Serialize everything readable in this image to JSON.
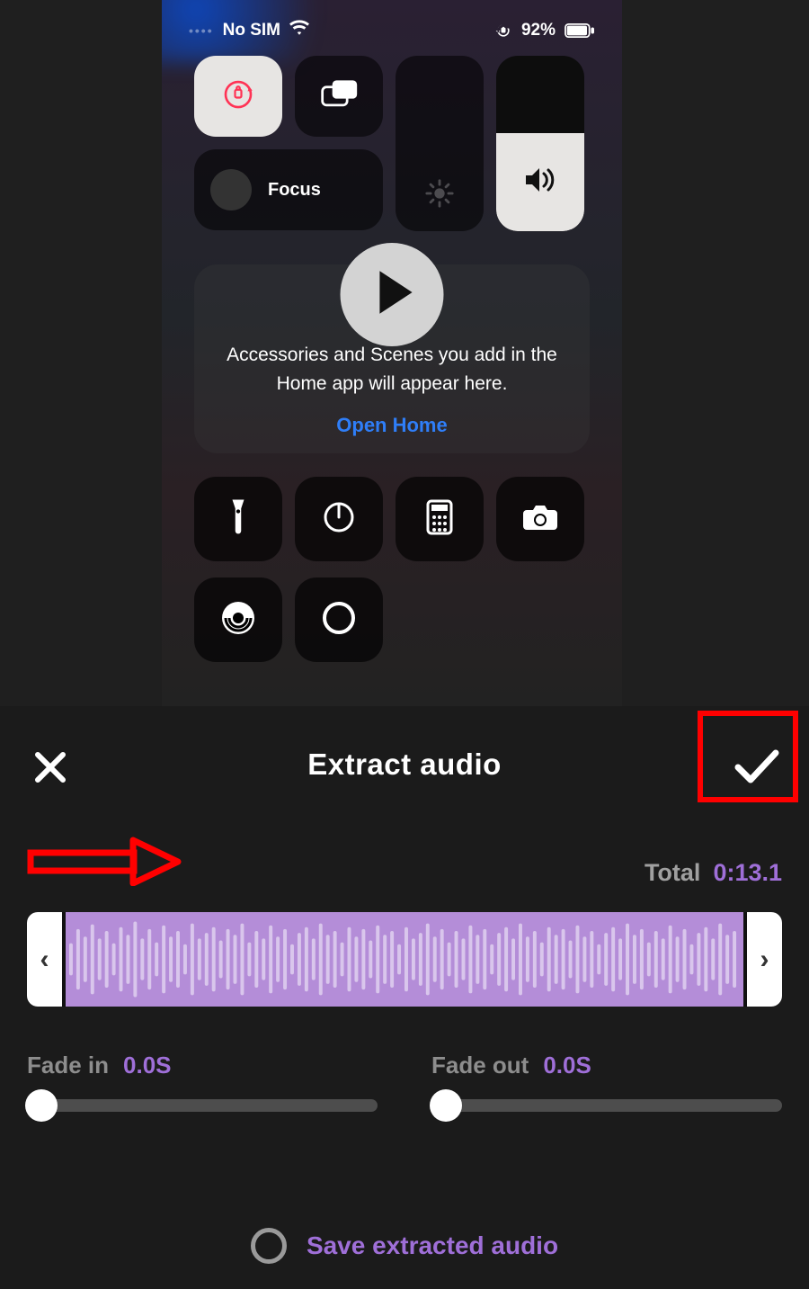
{
  "statusbar": {
    "carrier": "No SIM",
    "battery_pct": "92%"
  },
  "preview": {
    "focus_label": "Focus",
    "home_text": "Accessories and Scenes you add in the Home app will appear here.",
    "open_home": "Open Home"
  },
  "panel": {
    "title": "Extract audio",
    "total_label": "Total",
    "total_time": "0:13.1",
    "fade_in_label": "Fade in",
    "fade_in_value": "0.0S",
    "fade_out_label": "Fade out",
    "fade_out_value": "0.0S",
    "save_label": "Save extracted audio"
  }
}
